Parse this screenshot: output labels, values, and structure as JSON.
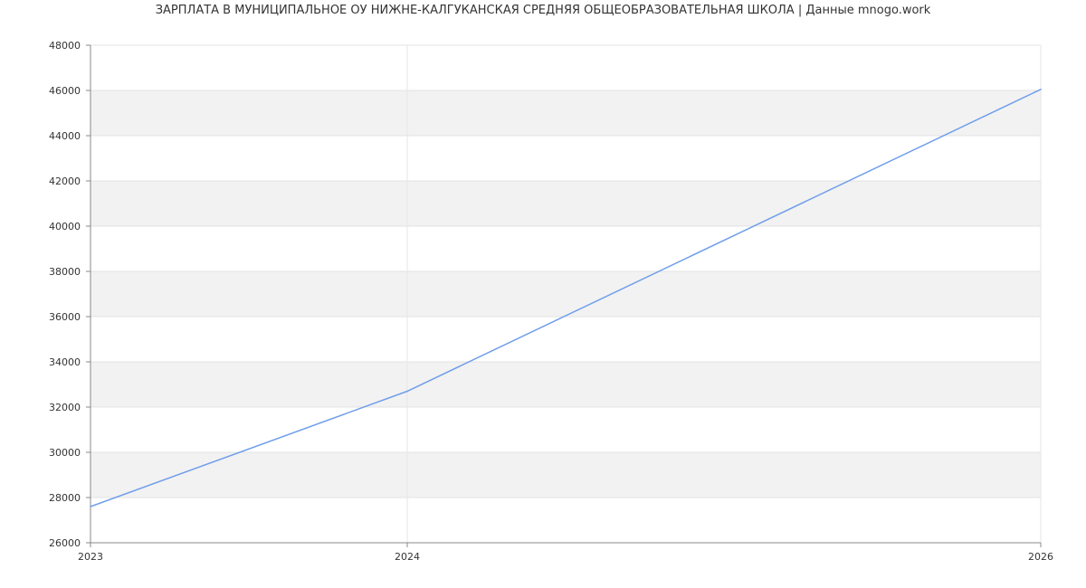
{
  "chart_data": {
    "type": "line",
    "title": "ЗАРПЛАТА В МУНИЦИПАЛЬНОЕ ОУ НИЖНЕ-КАЛГУКАНСКАЯ СРЕДНЯЯ ОБЩЕОБРАЗОВАТЕЛЬНАЯ ШКОЛА | Данные mnogo.work",
    "xlabel": "",
    "ylabel": "",
    "x": [
      "2023",
      "2024",
      "2026"
    ],
    "series": [
      {
        "values": [
          27600,
          32700,
          46050
        ]
      }
    ],
    "ylim": [
      26000,
      48000
    ],
    "yticks": [
      26000,
      28000,
      30000,
      32000,
      34000,
      36000,
      38000,
      40000,
      42000,
      44000,
      46000,
      48000
    ],
    "grid": true,
    "line_color": "#6f9eea",
    "band_color": "#f2f2f2"
  }
}
